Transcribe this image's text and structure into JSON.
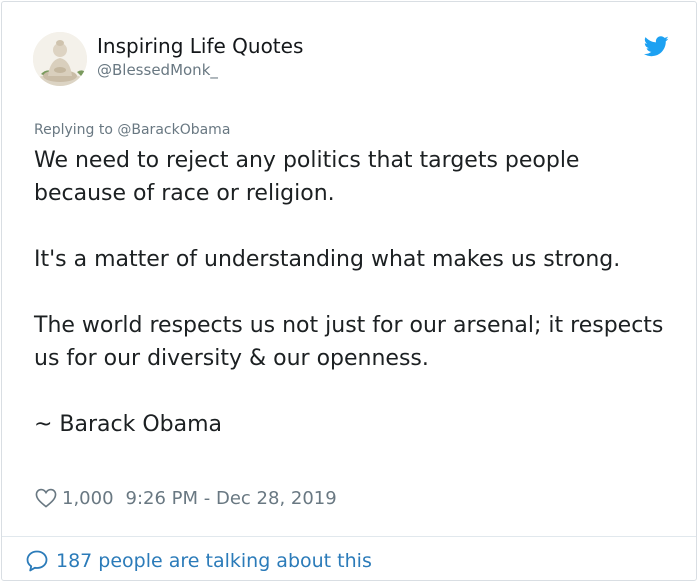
{
  "author": {
    "display_name": "Inspiring Life Quotes",
    "handle": "@BlessedMonk_",
    "avatar_icon": "buddha-statue-avatar"
  },
  "reply_context": "Replying to @BarackObama",
  "tweet": {
    "paragraphs": [
      "We need to reject any politics that targets people because of race or religion.",
      "It's a matter of understanding what makes us strong.",
      "The world respects us not just for our arsenal; it respects us for our diversity & our openness.",
      "~ Barack Obama"
    ]
  },
  "meta": {
    "likes": "1,000",
    "timestamp": "9:26 PM - Dec 28, 2019"
  },
  "footer": {
    "conversation_label": "187 people are talking about this"
  },
  "colors": {
    "twitter_blue": "#1da1f2",
    "link_blue": "#2b7bb9",
    "secondary_text": "#697882",
    "primary_text": "#1c2022"
  }
}
